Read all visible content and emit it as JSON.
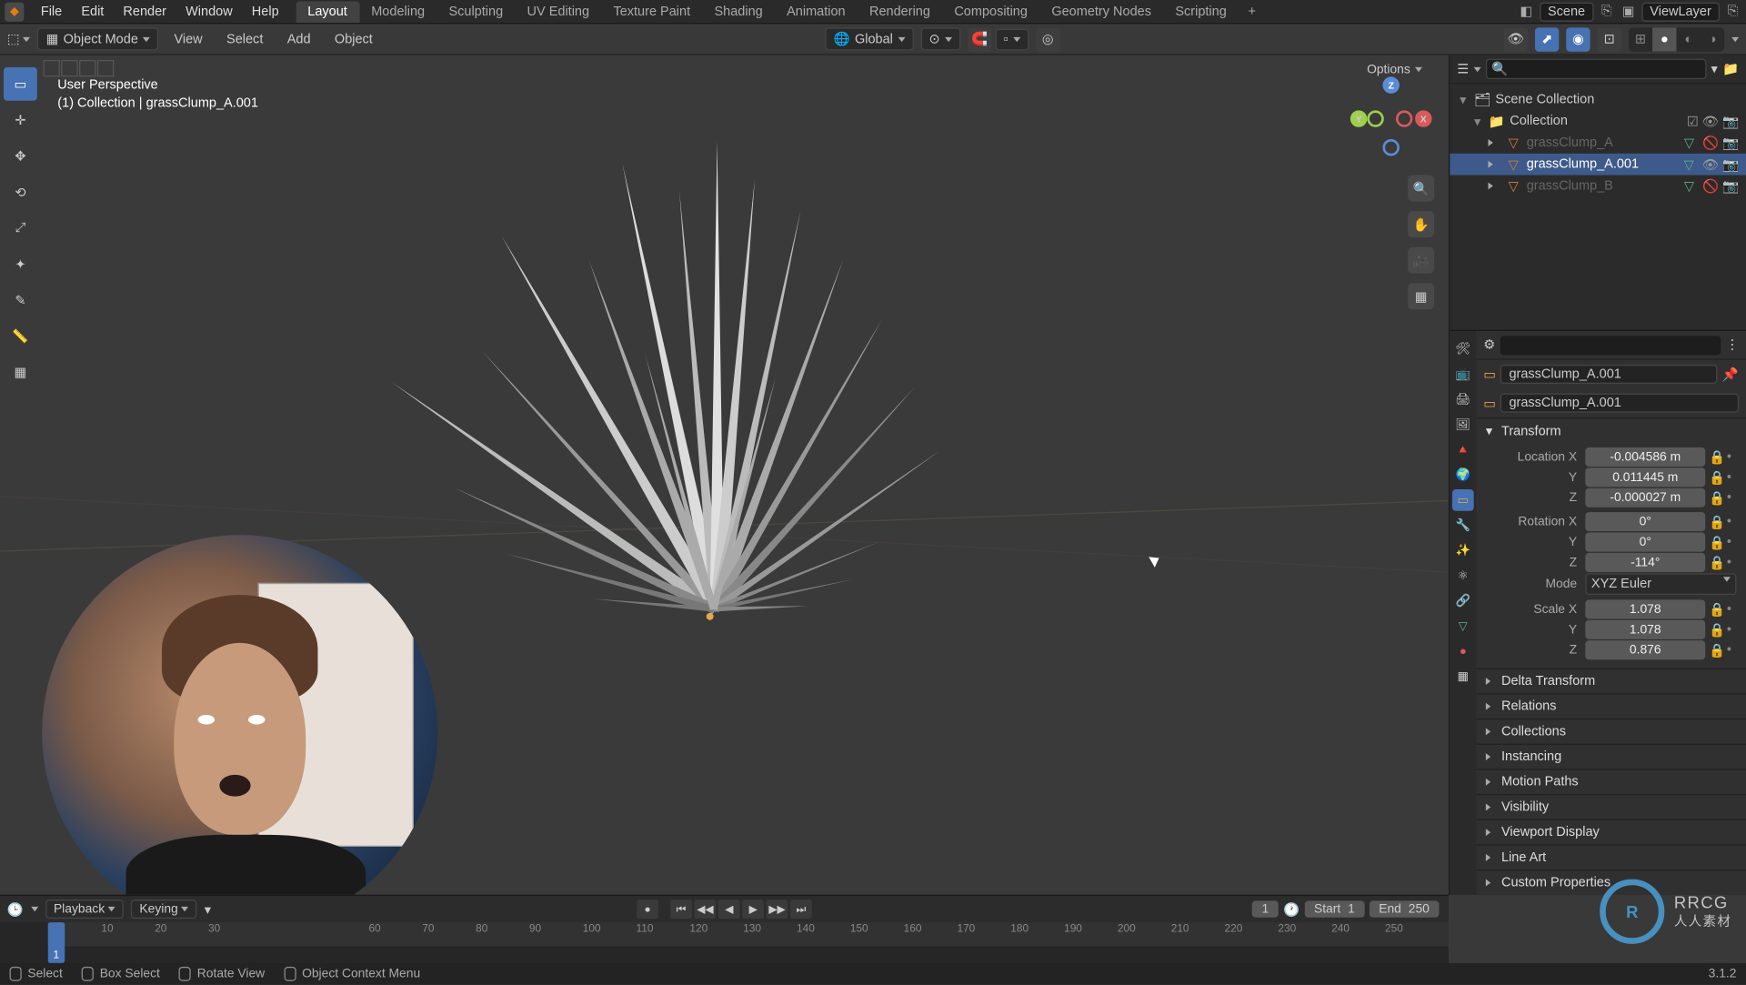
{
  "menubar": {
    "items": [
      "File",
      "Edit",
      "Render",
      "Window",
      "Help"
    ],
    "tabs": [
      "Layout",
      "Modeling",
      "Sculpting",
      "UV Editing",
      "Texture Paint",
      "Shading",
      "Animation",
      "Rendering",
      "Compositing",
      "Geometry Nodes",
      "Scripting"
    ],
    "active_tab": "Layout",
    "scene_label": "Scene",
    "viewlayer_label": "ViewLayer"
  },
  "toolbar": {
    "mode": "Object Mode",
    "menus": [
      "View",
      "Select",
      "Add",
      "Object"
    ],
    "orientation": "Global",
    "options_label": "Options"
  },
  "viewport": {
    "perspective": "User Perspective",
    "context": "(1) Collection | grassClump_A.001"
  },
  "outliner": {
    "root": "Scene Collection",
    "collection": "Collection",
    "items": [
      {
        "name": "grassClump_A",
        "selected": false,
        "hidden": true
      },
      {
        "name": "grassClump_A.001",
        "selected": true,
        "hidden": false
      },
      {
        "name": "grassClump_B",
        "selected": false,
        "hidden": true
      }
    ]
  },
  "properties": {
    "object_name": "grassClump_A.001",
    "data_name": "grassClump_A.001",
    "transform_title": "Transform",
    "location_label": "Location X",
    "rotation_label": "Rotation X",
    "scale_label": "Scale X",
    "mode_label": "Mode",
    "mode_value": "XYZ Euler",
    "loc": [
      "-0.004586 m",
      "0.011445 m",
      "-0.000027 m"
    ],
    "rot": [
      "0°",
      "0°",
      "-114°"
    ],
    "scale": [
      "1.078",
      "1.078",
      "0.876"
    ],
    "axis_y": "Y",
    "axis_z": "Z",
    "panels": [
      "Delta Transform",
      "Relations",
      "Collections",
      "Instancing",
      "Motion Paths",
      "Visibility",
      "Viewport Display",
      "Line Art",
      "Custom Properties"
    ]
  },
  "timeline": {
    "playback": "Playback",
    "keying": "Keying",
    "current": "1",
    "start_label": "Start",
    "start": "1",
    "end_label": "End",
    "end": "250",
    "ticks": [
      "10",
      "20",
      "30",
      "60",
      "70",
      "80",
      "90",
      "100",
      "110",
      "120",
      "130",
      "140",
      "150",
      "160",
      "170",
      "180",
      "190",
      "200",
      "210",
      "220",
      "230",
      "240",
      "250"
    ]
  },
  "status": {
    "select": "Select",
    "box": "Box Select",
    "rotate": "Rotate View",
    "context": "Object Context Menu",
    "version": "3.1.2"
  },
  "watermark": {
    "logo": "R",
    "text": "RRCG",
    "sub": "人人素材"
  }
}
